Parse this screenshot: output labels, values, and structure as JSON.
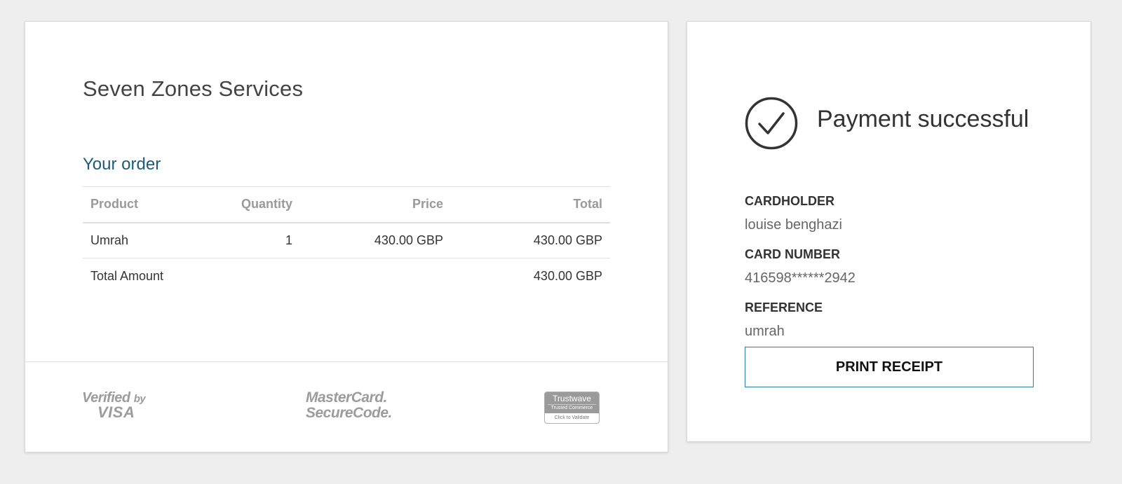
{
  "order": {
    "merchant_name": "Seven Zones Services",
    "heading": "Your order",
    "columns": {
      "product": "Product",
      "quantity": "Quantity",
      "price": "Price",
      "total": "Total"
    },
    "items": [
      {
        "product": "Umrah",
        "quantity": "1",
        "price": "430.00 GBP",
        "total": "430.00 GBP"
      }
    ],
    "total_label": "Total Amount",
    "total_value": "430.00 GBP",
    "heading_color": "#1a5c7a"
  },
  "footer": {
    "visa": {
      "line1": "Verified",
      "line1_suffix": "by",
      "line2": "VISA"
    },
    "mastercard": {
      "line1": "MasterCard.",
      "line2": "SecureCode."
    },
    "trustwave": {
      "name": "Trustwave",
      "subtitle": "Trusted Commerce",
      "action": "Click to Validate"
    }
  },
  "status": {
    "icon": "check-circle-icon",
    "title": "Payment successful",
    "cardholder_label": "CARDHOLDER",
    "cardholder_value": "louise benghazi",
    "card_number_label": "CARD NUMBER",
    "card_number_value": "416598******2942",
    "reference_label": "REFERENCE",
    "reference_value": "umrah",
    "print_button": "PRINT RECEIPT",
    "button_border_color": "#2b7aa8"
  }
}
